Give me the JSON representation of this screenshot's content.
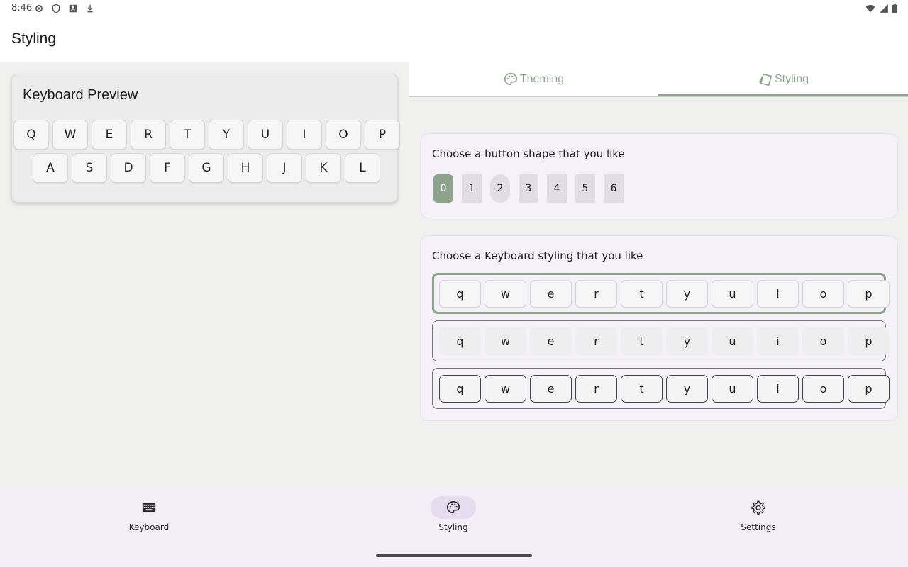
{
  "status": {
    "time": "8:46"
  },
  "app": {
    "title": "Styling"
  },
  "preview": {
    "title": "Keyboard Preview",
    "row1": [
      "Q",
      "W",
      "E",
      "R",
      "T",
      "Y",
      "U",
      "I",
      "O",
      "P"
    ],
    "row2": [
      "A",
      "S",
      "D",
      "F",
      "G",
      "H",
      "J",
      "K",
      "L"
    ]
  },
  "tabs": [
    {
      "label": "Theming",
      "icon": "palette-icon"
    },
    {
      "label": "Styling",
      "icon": "shapes-icon"
    }
  ],
  "shapes_card": {
    "title": "Choose a button shape that you like",
    "options": [
      "0",
      "1",
      "2",
      "3",
      "4",
      "5",
      "6"
    ],
    "selected": "0"
  },
  "styling_card": {
    "title": "Choose a Keyboard styling that you like",
    "options": [
      {
        "keys": [
          "q",
          "w",
          "e",
          "r",
          "t",
          "y",
          "u",
          "i",
          "o",
          "p"
        ],
        "selected": true
      },
      {
        "keys": [
          "q",
          "w",
          "e",
          "r",
          "t",
          "y",
          "u",
          "i",
          "o",
          "p"
        ],
        "selected": false
      },
      {
        "keys": [
          "q",
          "w",
          "e",
          "r",
          "t",
          "y",
          "u",
          "i",
          "o",
          "p"
        ],
        "selected": false
      }
    ]
  },
  "nav": [
    {
      "label": "Keyboard",
      "icon": "keyboard-icon",
      "active": false
    },
    {
      "label": "Styling",
      "icon": "palette-icon",
      "active": true
    },
    {
      "label": "Settings",
      "icon": "gear-icon",
      "active": false
    }
  ],
  "colors": {
    "accent": "#8ea38c",
    "card_bg": "#f5f1f8",
    "nav_bg": "#f3eef8"
  }
}
